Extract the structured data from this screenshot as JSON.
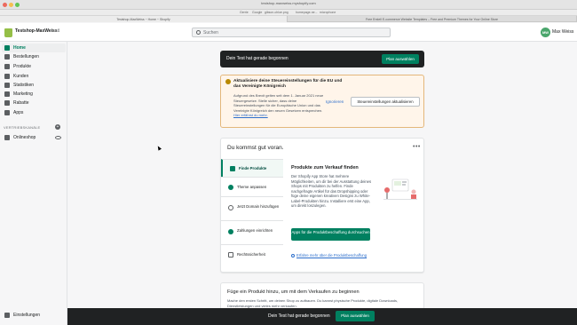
{
  "browser": {
    "url": "testshop-maxweiss.myshopify.com",
    "bookmarks": [
      "Gerrie",
      "Google",
      "gibson-chloe.png",
      "homepage-ne...",
      "microphone"
    ],
    "tabs": [
      {
        "label": "Testshop-MaxWeiss ~ Home ~ Shopify",
        "active": true
      },
      {
        "label": "Free Erstell E-commerce Website Templates – Free and Premium Themes for Your Online Store",
        "active": false
      }
    ]
  },
  "topbar": {
    "store_name": "Testshop-MaxWeiss",
    "search_placeholder": "Suchen",
    "user_initials": "MW",
    "user_name": "Max Weiss"
  },
  "sidebar": {
    "items": [
      {
        "label": "Home",
        "icon": "home-icon",
        "active": true
      },
      {
        "label": "Bestellungen",
        "icon": "orders-icon",
        "active": false
      },
      {
        "label": "Produkte",
        "icon": "tag-icon",
        "active": false
      },
      {
        "label": "Kunden",
        "icon": "customer-icon",
        "active": false
      },
      {
        "label": "Statistiken",
        "icon": "analytics-icon",
        "active": false
      },
      {
        "label": "Marketing",
        "icon": "marketing-icon",
        "active": false
      },
      {
        "label": "Rabatte",
        "icon": "discount-icon",
        "active": false
      },
      {
        "label": "Apps",
        "icon": "apps-icon",
        "active": false
      }
    ],
    "section_label": "VERTRIEBSKANÄLE",
    "channel": "Onlineshop",
    "settings": "Einstellungen"
  },
  "banner_top": {
    "text": "Dein Test hat gerade begonnen",
    "button": "Plan auswählen"
  },
  "notice": {
    "title": "Aktualisiere deine Steuereinstellungen für die EU und das Vereinigte Königreich",
    "body": "Aufgrund des Brexit gelten seit dem 1. Januar 2021 neue Steuergesetze. Stelle sicher, dass deine Steuereinstellungen für die Europäische Union und das Vereinigte Königreich den neuen Gesetzen entsprechen.",
    "link": "Hier erfährst du mehr.",
    "ignore": "Ignorieren",
    "button": "Steuereinstellungen aktualisieren"
  },
  "card": {
    "title": "Du kommst gut voran.",
    "steps": [
      {
        "label": "Finde Produkte",
        "done": true,
        "active": true
      },
      {
        "label": "Theme anpassen",
        "done": true,
        "active": false
      },
      {
        "label": "Jetzt Domain hinzufügen",
        "done": false,
        "active": false
      },
      {
        "label": "Zahlungen einrichten",
        "done": true,
        "active": false
      },
      {
        "label": "Rechtssicherheit",
        "done": false,
        "active": false
      }
    ],
    "content_title": "Produkte zum Verkauf finden",
    "content_body": "Der Shopify App Store hat mehrere Möglichkeiten, um dir bei der Ausstattung deines Shops mit Produkten zu helfen. Finde nachgefragte Artikel für das Dropshipping oder füge deine eigenen kreativen Designs zu White-Label-Produkten hinzu. Installiere erst eine App, um direkt loszulegen.",
    "content_button": "Apps für die Produktbeschaffung durchsuchen",
    "content_link": "Erfahre mehr über die Produktbeschaffung"
  },
  "card2": {
    "title": "Füge ein Produkt hinzu, um mit dem Verkaufen zu beginnen",
    "body": "Mache den ersten Schritt, um deinen Shop zu aufbauen. Du kannst physische Produkte, digitale Downloads, Dienstleistungen und vieles mehr verkaufen."
  },
  "bottombar": {
    "text": "Dein Test hat gerade begonnen",
    "button": "Plan auswählen"
  }
}
